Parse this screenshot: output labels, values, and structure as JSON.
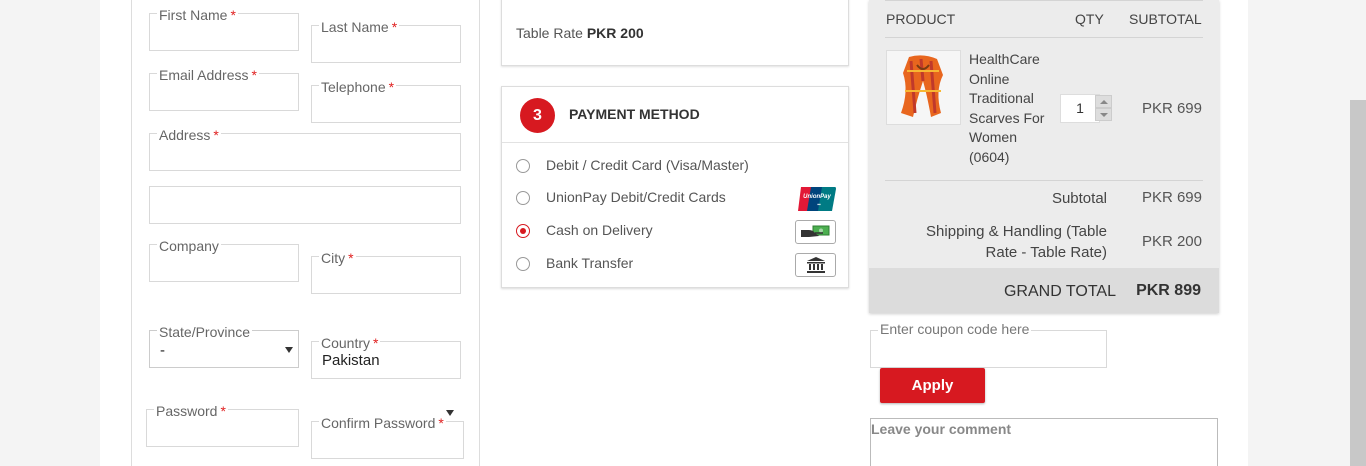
{
  "form": {
    "first_name": {
      "label": "First Name",
      "required": "*"
    },
    "last_name": {
      "label": "Last Name",
      "required": "*"
    },
    "email": {
      "label": "Email Address",
      "required": "*"
    },
    "telephone": {
      "label": "Telephone",
      "required": "*"
    },
    "address": {
      "label": "Address",
      "required": "*"
    },
    "company": {
      "label": "Company"
    },
    "city": {
      "label": "City",
      "required": "*"
    },
    "state": {
      "label": "State/Province",
      "value": "-"
    },
    "country": {
      "label": "Country",
      "required": "*",
      "value": "Pakistan"
    },
    "password": {
      "label": "Password",
      "required": "*"
    },
    "confirm_password": {
      "label": "Confirm Password",
      "required": "*"
    }
  },
  "shipping": {
    "rate_label": "Table Rate",
    "rate_value": "PKR 200"
  },
  "payment": {
    "step": "3",
    "title": "PAYMENT METHOD",
    "options": [
      {
        "label": "Debit / Credit Card (Visa/Master)",
        "selected": false,
        "icon": ""
      },
      {
        "label": "UnionPay Debit/Credit Cards",
        "selected": false,
        "icon": "unionpay-logo"
      },
      {
        "label": "Cash on Delivery",
        "selected": true,
        "icon": "cash-hand-icon"
      },
      {
        "label": "Bank Transfer",
        "selected": false,
        "icon": "bank-icon"
      }
    ],
    "accent": "#d71920"
  },
  "cart": {
    "headers": {
      "product": "PRODUCT",
      "qty": "QTY",
      "subtotal": "SUBTOTAL"
    },
    "item": {
      "name": "HealthCare Online Traditional Scarves For Women (0604)",
      "qty": "1",
      "price": "PKR 699",
      "image": "orange-scarf-thumbnail"
    },
    "subtotal": {
      "label": "Subtotal",
      "value": "PKR 699"
    },
    "shipping": {
      "label": "Shipping & Handling (Table Rate - Table Rate)",
      "value": "PKR 200"
    },
    "grand_total": {
      "label": "GRAND TOTAL",
      "value": "PKR 899"
    }
  },
  "coupon": {
    "placeholder": "Enter coupon code here",
    "apply_label": "Apply"
  },
  "comment": {
    "placeholder": "Leave your comment"
  }
}
